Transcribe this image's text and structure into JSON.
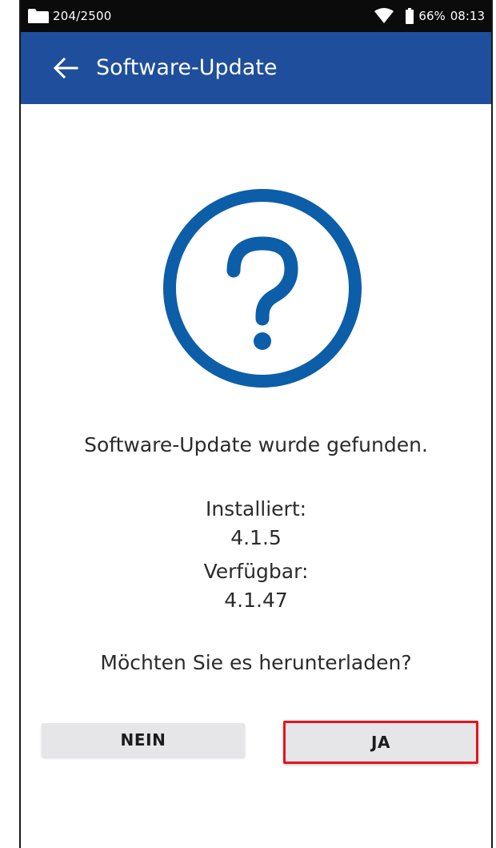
{
  "status_bar": {
    "storage": "204/2500",
    "battery": "66%",
    "time": "08:13",
    "icons": [
      "folder-icon",
      "wifi-icon",
      "battery-icon"
    ]
  },
  "app_bar": {
    "title": "Software-Update",
    "back_icon": "arrow-left-icon",
    "color": "#1f4e9c"
  },
  "dialog": {
    "icon": "question-mark-circle-icon",
    "icon_color": "#0c5ea8",
    "message": "Software-Update wurde gefunden.",
    "installed_label": "Installiert:",
    "installed_version": "4.1.5",
    "available_label": "Verfügbar:",
    "available_version": "4.1.47",
    "prompt": "Möchten Sie es herunterladen?"
  },
  "buttons": {
    "no_label": "NEIN",
    "yes_label": "JA",
    "highlight_color": "#e8131d"
  }
}
